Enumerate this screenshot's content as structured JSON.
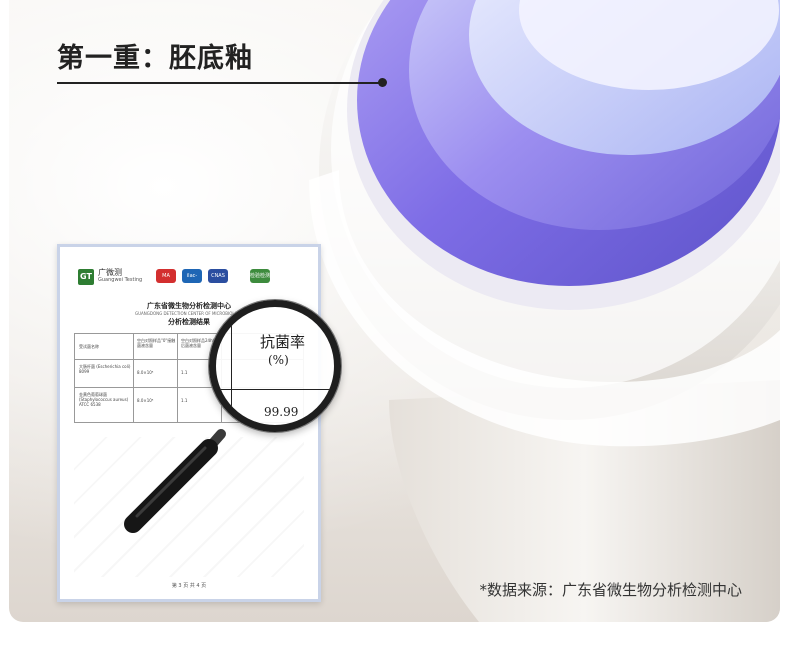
{
  "headline": "第一重：胚底釉",
  "footnote": "*数据来源：广东省微生物分析检测中心",
  "report": {
    "org_name": "广微测",
    "org_sub": "Guangwei Testing",
    "cert_labels": [
      "MA",
      "ilac-MRA",
      "CNAS",
      "检验检测"
    ],
    "title": "广东省微生物分析检测中心",
    "sub_title_en": "GUANGDONG DETECTION CENTER OF MICROBIOLOGY",
    "sub_title2": "分析检测结果",
    "table_headers": [
      "受试菌名称",
      "空白对照样品\"0\"接触菌液含量",
      "空白对照样品24h接触后菌液含量"
    ],
    "table_rows": [
      [
        "大肠杆菌 (Escherichia coli) 8099",
        "8.0×10⁵",
        "1.1"
      ],
      [
        "金黄色葡萄球菌 (Staphylococcus aureus) ATCC 6538",
        "8.0×10⁵",
        "1.1"
      ]
    ],
    "page_label": "第 3 页 共 4 页"
  },
  "lens": {
    "header_line1": "抗菌率",
    "header_line2": "(%)",
    "value": "99.99"
  },
  "colors": {
    "bowl_purple": "#8a72e0",
    "bowl_blue": "#7a86e6",
    "report_border": "#c9d3e8"
  }
}
